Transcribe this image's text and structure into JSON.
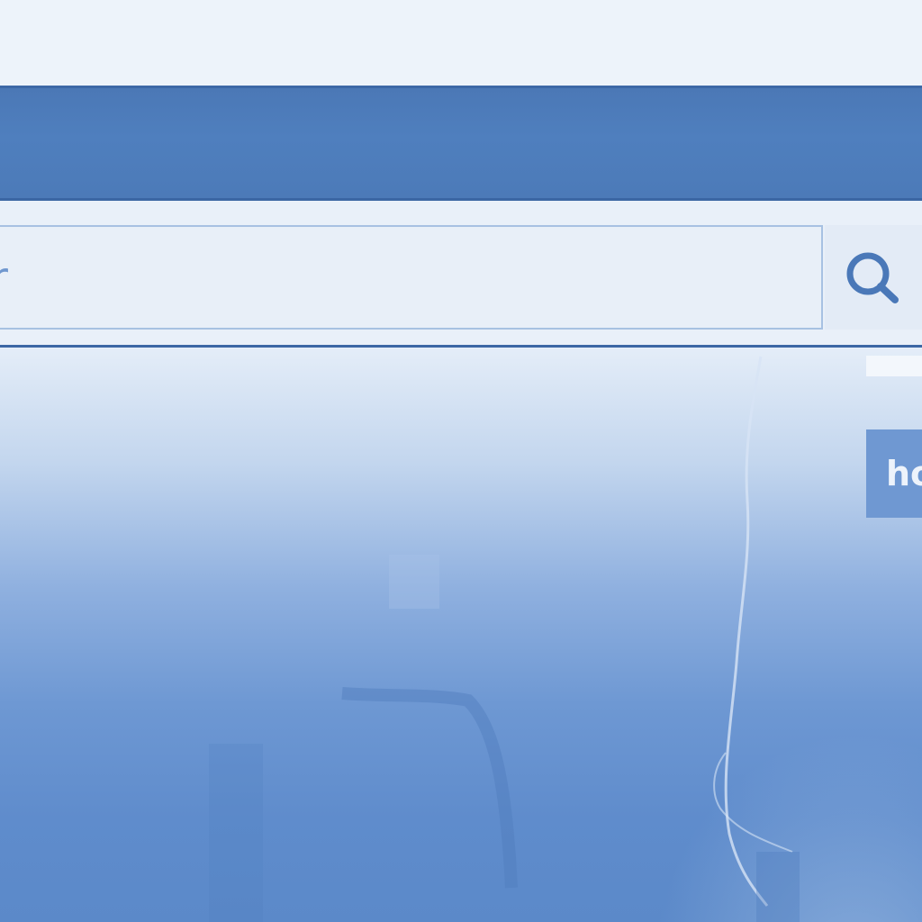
{
  "search": {
    "value": "r",
    "placeholder": ""
  },
  "icons": {
    "search": "search-icon"
  },
  "side_badge": {
    "label": "ho"
  },
  "colors": {
    "header": "#4f7fbe",
    "accent": "#3c67a5",
    "input_border": "#a7c1e2",
    "icon": "#4a78b8"
  }
}
